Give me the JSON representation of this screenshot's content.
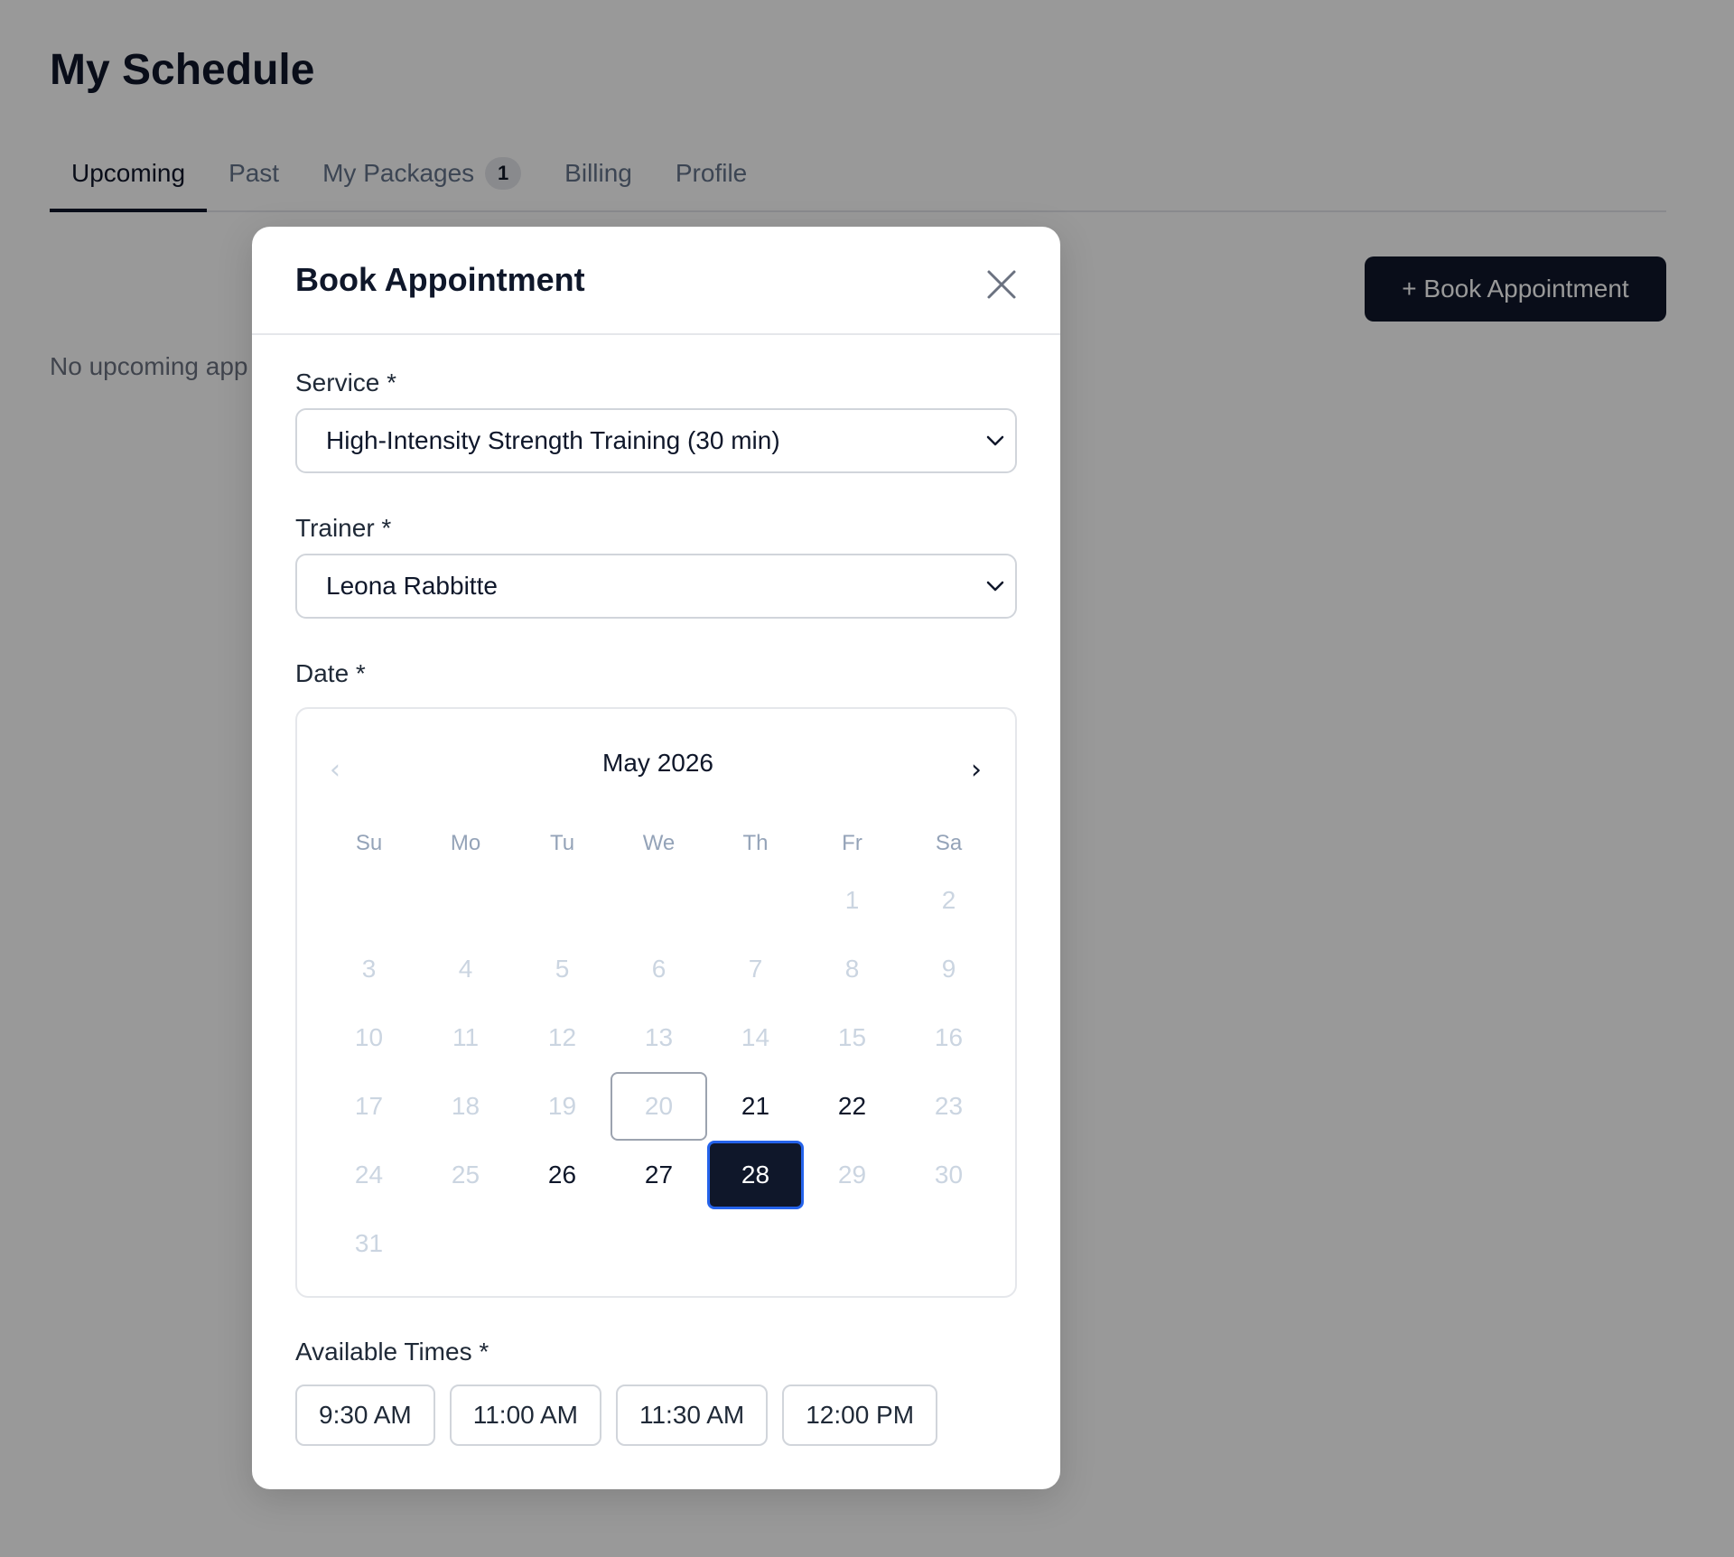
{
  "page": {
    "title": "My Schedule",
    "tabs": [
      {
        "label": "Upcoming",
        "active": true
      },
      {
        "label": "Past"
      },
      {
        "label": "My Packages",
        "badge": "1"
      },
      {
        "label": "Billing"
      },
      {
        "label": "Profile"
      }
    ],
    "book_button_label": "+ Book Appointment",
    "empty_text": "No upcoming app"
  },
  "modal": {
    "title": "Book Appointment",
    "service": {
      "label": "Service *",
      "value": "High-Intensity Strength Training (30 min)"
    },
    "trainer": {
      "label": "Trainer *",
      "value": "Leona Rabbitte"
    },
    "date": {
      "label": "Date *",
      "month_label": "May 2026",
      "weekdays": [
        "Su",
        "Mo",
        "Tu",
        "We",
        "Th",
        "Fr",
        "Sa"
      ],
      "leading_blanks": 5,
      "days_in_month": 31,
      "today": 20,
      "selected": 28,
      "available": [
        21,
        22,
        26,
        27,
        28
      ]
    },
    "times": {
      "label": "Available Times *",
      "options": [
        "9:30 AM",
        "11:00 AM",
        "11:30 AM",
        "12:00 PM"
      ]
    }
  },
  "colors": {
    "primary": "#0f172a",
    "selected_outline": "#2563eb",
    "muted_text": "#cbd5e1",
    "overlay": "rgba(0,0,0,0.4)"
  }
}
